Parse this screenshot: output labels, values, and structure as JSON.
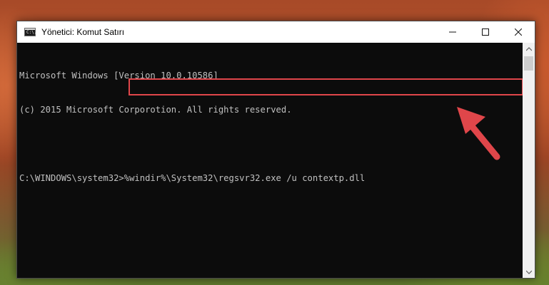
{
  "window": {
    "title": "Yönetici: Komut Satırı",
    "icon_text": "C:\\."
  },
  "console": {
    "lines": [
      "Microsoft Windows [Version 10.0.10586]",
      "(c) 2015 Microsoft Corporotion. All rights reserved.",
      "",
      "C:\\WINDOWS\\system32>%windir%\\System32\\regsvr32.exe /u contextp.dll"
    ],
    "highlighted_command": "%windir%\\System32\\regsvr32.exe /u contextp.dll",
    "highlight_color": "#e0464a"
  },
  "icons": {
    "minimize": "minimize-icon",
    "maximize": "maximize-icon",
    "close": "close-icon",
    "annotation": "red-arrow-icon"
  },
  "colors": {
    "console_bg": "#0c0c0c",
    "console_text": "#c0c0c0",
    "arrow": "#e0464a"
  }
}
